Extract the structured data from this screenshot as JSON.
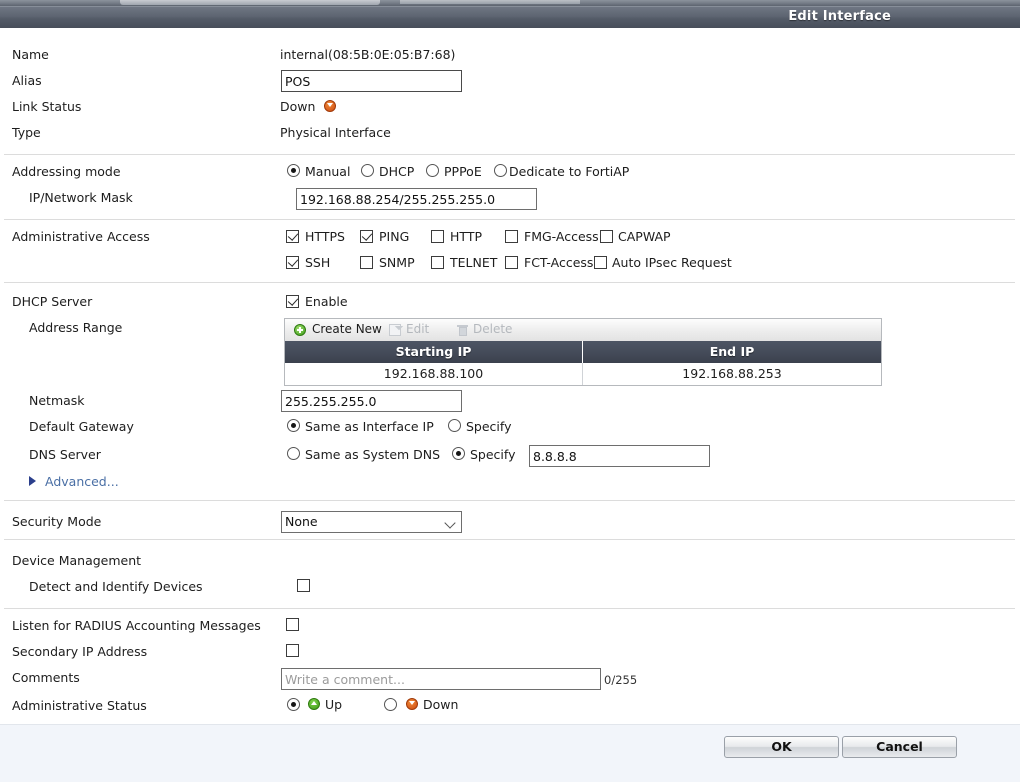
{
  "window": {
    "title": "Edit Interface"
  },
  "fields": {
    "name_label": "Name",
    "name_value": "internal(08:5B:0E:05:B7:68)",
    "alias_label": "Alias",
    "alias_value": "POS",
    "link_status_label": "Link Status",
    "link_status_value": "Down",
    "link_status_icon": "arrow-down-orange-icon",
    "type_label": "Type",
    "type_value": "Physical Interface"
  },
  "addressing": {
    "label": "Addressing mode",
    "options": [
      "Manual",
      "DHCP",
      "PPPoE",
      "Dedicate to FortiAP"
    ],
    "selected": "Manual",
    "ip_mask_label": "IP/Network Mask",
    "ip_mask_value": "192.168.88.254/255.255.255.0"
  },
  "admin_access": {
    "label": "Administrative Access",
    "row1": [
      {
        "label": "HTTPS",
        "checked": true
      },
      {
        "label": "PING",
        "checked": true
      },
      {
        "label": "HTTP",
        "checked": false
      },
      {
        "label": "FMG-Access",
        "checked": false
      },
      {
        "label": "CAPWAP",
        "checked": false
      }
    ],
    "row2": [
      {
        "label": "SSH",
        "checked": true
      },
      {
        "label": "SNMP",
        "checked": false
      },
      {
        "label": "TELNET",
        "checked": false
      },
      {
        "label": "FCT-Access",
        "checked": false
      },
      {
        "label": "Auto IPsec Request",
        "checked": false
      }
    ]
  },
  "dhcp": {
    "label": "DHCP Server",
    "enable_label": "Enable",
    "enabled": true,
    "address_range_label": "Address Range",
    "toolbar": {
      "create_new": "Create New",
      "edit": "Edit",
      "delete": "Delete"
    },
    "table": {
      "columns": [
        "Starting IP",
        "End IP"
      ],
      "rows": [
        [
          "192.168.88.100",
          "192.168.88.253"
        ]
      ]
    },
    "netmask_label": "Netmask",
    "netmask_value": "255.255.255.0",
    "gateway_label": "Default Gateway",
    "gateway_options": [
      "Same as Interface IP",
      "Specify"
    ],
    "gateway_selected": "Same as Interface IP",
    "dns_label": "DNS Server",
    "dns_options": [
      "Same as System DNS",
      "Specify"
    ],
    "dns_selected": "Specify",
    "dns_value": "8.8.8.8",
    "advanced_label": "Advanced..."
  },
  "security": {
    "label": "Security Mode",
    "value": "None",
    "options": [
      "None"
    ]
  },
  "device_management": {
    "label": "Device Management",
    "detect_label": "Detect and Identify Devices",
    "detect_checked": false
  },
  "misc": {
    "radius_label": "Listen for RADIUS Accounting Messages",
    "radius_checked": false,
    "secondary_ip_label": "Secondary IP Address",
    "secondary_ip_checked": false,
    "comments_label": "Comments",
    "comments_value": "",
    "comments_placeholder": "Write a comment...",
    "comments_counter": "0/255",
    "admin_status_label": "Administrative Status",
    "admin_status_options": [
      "Up",
      "Down"
    ],
    "admin_status_selected": "Up"
  },
  "footer": {
    "ok_label": "OK",
    "cancel_label": "Cancel"
  },
  "colors": {
    "accent": "#4a6fa5",
    "status_down": "#cf4b10",
    "status_up": "#3f9a18",
    "header_bg": "#454c5a"
  }
}
